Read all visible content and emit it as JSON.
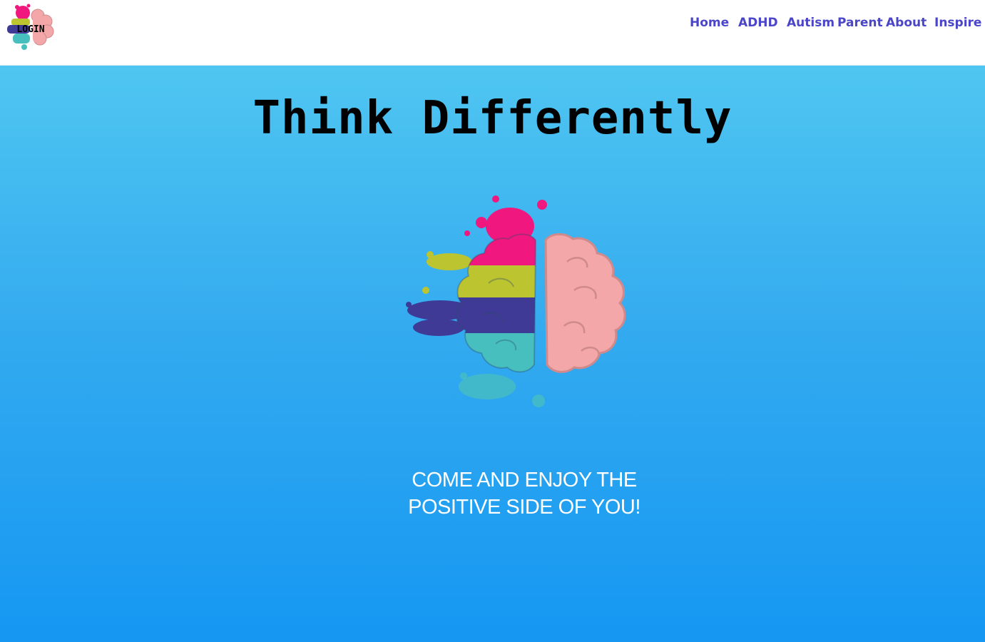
{
  "header": {
    "logo": {
      "icon": "brain-splash-logo-icon",
      "text": "LOGIN"
    },
    "nav": [
      {
        "label": "Home"
      },
      {
        "label": "ADHD"
      },
      {
        "label": "Autism"
      },
      {
        "label": "Parent"
      },
      {
        "label": "About"
      },
      {
        "label": "Inspire"
      }
    ]
  },
  "hero": {
    "title": "Think Differently",
    "illustration": "colorful-brain-icon",
    "tagline": {
      "line1": "COME AND ENJOY THE",
      "line2": "POSITIVE SIDE OF YOU!"
    }
  },
  "colors": {
    "nav_link": "#4b45c8",
    "hero_top": "#4fc6f1",
    "hero_bottom": "#1597f2",
    "title": "#000000",
    "tagline": "#ffffff",
    "brain_pink": "#f0177e",
    "brain_olive": "#bcc42f",
    "brain_indigo": "#3f3a95",
    "brain_teal": "#48bfbf",
    "brain_right": "#f3a7a8"
  }
}
